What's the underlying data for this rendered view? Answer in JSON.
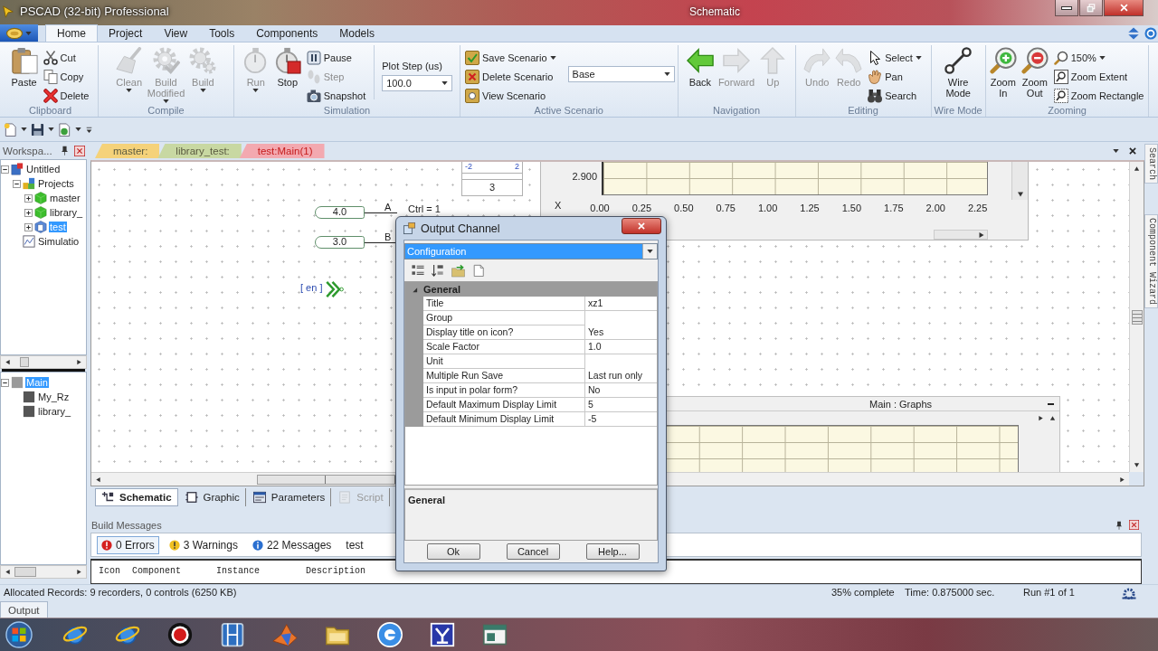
{
  "title_bar": {
    "app_title": "PSCAD (32-bit) Professional",
    "document_title": "Schematic"
  },
  "ribbon": {
    "tabs": [
      {
        "label": "Home",
        "selected": true
      },
      {
        "label": "Project",
        "selected": false
      },
      {
        "label": "View",
        "selected": false
      },
      {
        "label": "Tools",
        "selected": false
      },
      {
        "label": "Components",
        "selected": false
      },
      {
        "label": "Models",
        "selected": false
      }
    ],
    "groups": [
      {
        "name": "Clipboard",
        "items": [
          {
            "kind": "large",
            "label": "Paste",
            "disabled": false,
            "has_menu": false
          },
          {
            "kind": "stack",
            "items": [
              {
                "label": "Cut",
                "disabled": false,
                "has_menu": false
              },
              {
                "label": "Copy",
                "disabled": false,
                "has_menu": false
              },
              {
                "label": "Delete",
                "disabled": false,
                "has_menu": false
              }
            ]
          }
        ]
      },
      {
        "name": "Compile",
        "items": [
          {
            "kind": "large",
            "label": "Clean",
            "disabled": true,
            "has_menu": true
          },
          {
            "kind": "large",
            "label": "Build Modified",
            "disabled": true,
            "has_menu": true
          },
          {
            "kind": "large",
            "label": "Build",
            "disabled": true,
            "has_menu": true
          }
        ]
      },
      {
        "name": "Simulation",
        "items": [
          {
            "kind": "large",
            "label": "Run",
            "disabled": true,
            "has_menu": true
          },
          {
            "kind": "large",
            "label": "Stop",
            "disabled": false,
            "has_menu": false
          },
          {
            "kind": "stack",
            "items": [
              {
                "label": "Pause",
                "disabled": false,
                "has_menu": false
              },
              {
                "label": "Step",
                "disabled": true,
                "has_menu": false
              },
              {
                "label": "Snapshot",
                "disabled": false,
                "has_menu": false
              }
            ]
          },
          {
            "kind": "field",
            "label": "Plot Step (us)",
            "value": "100.0"
          }
        ]
      },
      {
        "name": "Active Scenario",
        "items": [
          {
            "kind": "stack",
            "items": [
              {
                "label": "Save Scenario",
                "disabled": false,
                "has_menu": true
              },
              {
                "label": "Delete Scenario",
                "disabled": false,
                "has_menu": false
              },
              {
                "label": "View Scenario",
                "disabled": false,
                "has_menu": false
              }
            ]
          },
          {
            "kind": "combo",
            "value": "Base"
          }
        ]
      },
      {
        "name": "Navigation",
        "items": [
          {
            "kind": "large",
            "label": "Back",
            "disabled": false,
            "has_menu": false
          },
          {
            "kind": "large",
            "label": "Forward",
            "disabled": true,
            "has_menu": false
          },
          {
            "kind": "large",
            "label": "Up",
            "disabled": true,
            "has_menu": false
          }
        ]
      },
      {
        "name": "Editing",
        "items": [
          {
            "kind": "large",
            "label": "Undo",
            "disabled": true,
            "has_menu": false
          },
          {
            "kind": "large",
            "label": "Redo",
            "disabled": true,
            "has_menu": false
          },
          {
            "kind": "stack",
            "items": [
              {
                "label": "Select",
                "disabled": false,
                "has_menu": true
              },
              {
                "label": "Pan",
                "disabled": false,
                "has_menu": false
              },
              {
                "label": "Search",
                "disabled": false,
                "has_menu": false
              }
            ]
          }
        ]
      },
      {
        "name": "Wire Mode",
        "items": [
          {
            "kind": "large",
            "label": "Wire Mode",
            "disabled": false,
            "has_menu": false
          }
        ]
      },
      {
        "name": "Zooming",
        "items": [
          {
            "kind": "large",
            "label": "Zoom In",
            "disabled": false,
            "has_menu": false
          },
          {
            "kind": "large",
            "label": "Zoom Out",
            "disabled": false,
            "has_menu": false
          },
          {
            "kind": "stack",
            "items": [
              {
                "label": "150%",
                "disabled": false,
                "has_menu": true
              },
              {
                "label": "Zoom Extent",
                "disabled": false,
                "has_menu": false
              },
              {
                "label": "Zoom Rectangle",
                "disabled": false,
                "has_menu": false
              }
            ]
          }
        ]
      }
    ]
  },
  "workspace": {
    "title": "Workspa...",
    "tree": [
      {
        "label": "Untitled",
        "kind": "workspace",
        "expanded": true,
        "selected": false,
        "children": [
          {
            "label": "Projects",
            "kind": "projects",
            "expanded": true,
            "selected": false,
            "children": [
              {
                "label": "master",
                "kind": "library",
                "expanded": false,
                "selected": false
              },
              {
                "label": "library_",
                "kind": "library",
                "expanded": false,
                "selected": false
              },
              {
                "label": "test",
                "kind": "case",
                "expanded": false,
                "selected": true
              }
            ]
          },
          {
            "label": "Simulatio",
            "kind": "simulation",
            "selected": false
          }
        ]
      }
    ],
    "hierarchy": [
      {
        "label": "Main",
        "kind": "module",
        "expanded": true,
        "selected": true,
        "children": [
          {
            "label": "My_Rz",
            "kind": "component",
            "selected": false
          },
          {
            "label": "library_",
            "kind": "component",
            "selected": false
          }
        ]
      }
    ]
  },
  "document_tabs": [
    {
      "label": "master:",
      "color": "#f5d27a",
      "selected": false
    },
    {
      "label": "library_test:",
      "color": "#c8d8a2",
      "selected": false
    },
    {
      "label": "test:Main(1)",
      "color": "#f3a9b0",
      "selected": true
    }
  ],
  "schematic": {
    "constants": [
      {
        "value": "4.0",
        "port": "A"
      },
      {
        "value": "3.0",
        "port": "B"
      }
    ],
    "control_text": "Ctrl = 1",
    "signal_label": "[ en ]",
    "table": {
      "header": [
        "-2",
        "2"
      ],
      "value": "3"
    },
    "graph": {
      "y_tick": "2.900",
      "x_label": "X",
      "x_ticks": [
        "0.00",
        "0.25",
        "0.50",
        "0.75",
        "1.00",
        "1.25",
        "1.50",
        "1.75",
        "2.00",
        "2.25"
      ]
    },
    "graph_panel": {
      "title": "Main : Graphs"
    }
  },
  "view_tabs": [
    {
      "label": "Schematic",
      "selected": true,
      "disabled": false
    },
    {
      "label": "Graphic",
      "selected": false,
      "disabled": false
    },
    {
      "label": "Parameters",
      "selected": false,
      "disabled": false
    },
    {
      "label": "Script",
      "selected": false,
      "disabled": true
    }
  ],
  "side_tabs": [
    "Search",
    "Component Wizard"
  ],
  "build_messages": {
    "title": "Build Messages",
    "tabs": [
      {
        "label": "0 Errors",
        "kind": "error",
        "selected": true
      },
      {
        "label": "3 Warnings",
        "kind": "warning",
        "selected": false
      },
      {
        "label": "22 Messages",
        "kind": "info",
        "selected": false
      },
      {
        "label": "test",
        "kind": "plain",
        "selected": false
      }
    ],
    "columns": [
      "Icon",
      "Component",
      "Instance",
      "Description"
    ]
  },
  "status_bar": {
    "records": "Allocated Records: 9 recorders, 0 controls (6250 KB)",
    "progress": "35% complete",
    "time": "Time: 0.875000 sec.",
    "run": "Run #1 of 1"
  },
  "output_tab": "Output",
  "dialog": {
    "title": "Output Channel",
    "view": "Configuration",
    "category": {
      "label": "General",
      "expanded": true
    },
    "properties": [
      {
        "name": "Title",
        "value": "xz1"
      },
      {
        "name": "Group"
      },
      {
        "name": "Display title on icon?",
        "value": "Yes"
      },
      {
        "name": "Scale Factor",
        "value": "1.0"
      },
      {
        "name": "Unit"
      },
      {
        "name": "Multiple Run Save",
        "value": "Last run only"
      },
      {
        "name": "Is input in polar form?",
        "value": "No"
      },
      {
        "name": "Default Maximum Display Limit",
        "value": "5"
      },
      {
        "name": "Default Minimum Display Limit",
        "value": "-5"
      }
    ],
    "description_title": "General",
    "buttons": [
      "Ok",
      "Cancel",
      "Help..."
    ]
  }
}
